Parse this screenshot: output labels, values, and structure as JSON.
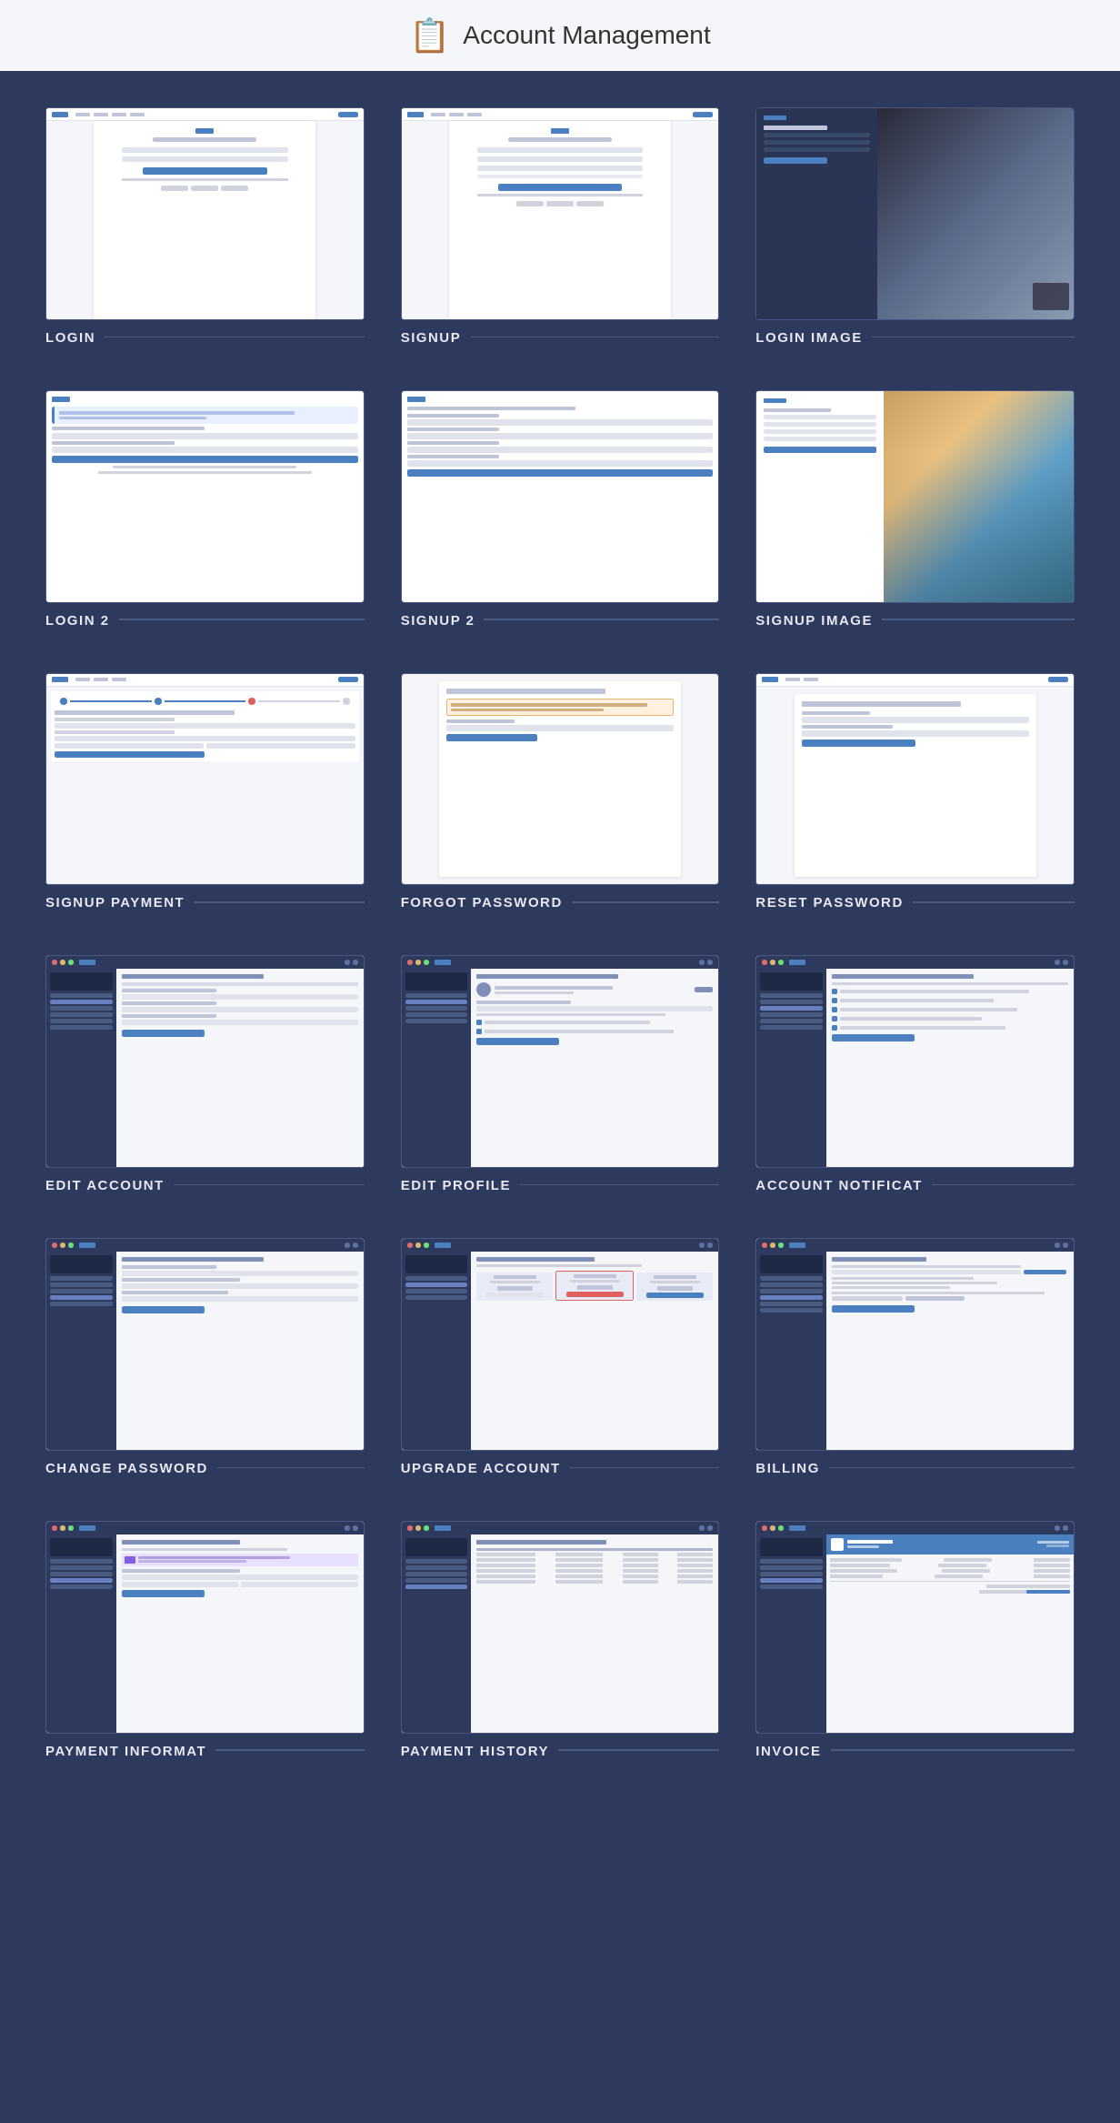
{
  "header": {
    "icon": "📋",
    "title": "Account Management"
  },
  "items": [
    {
      "id": "login",
      "label": "LOGIN",
      "type": "login"
    },
    {
      "id": "signup",
      "label": "SIGNUP",
      "type": "signup"
    },
    {
      "id": "login-image",
      "label": "LOGIN IMAGE",
      "type": "login-image"
    },
    {
      "id": "login2",
      "label": "LOGIN 2",
      "type": "login2"
    },
    {
      "id": "signup2",
      "label": "SIGNUP 2",
      "type": "signup2"
    },
    {
      "id": "signup-image",
      "label": "SIGNUP IMAGE",
      "type": "signup-image"
    },
    {
      "id": "signup-payment",
      "label": "SIGNUP PAYMENT",
      "type": "signup-payment"
    },
    {
      "id": "forgot-password",
      "label": "FORGOT PASSWORD",
      "type": "forgot-password"
    },
    {
      "id": "reset-password",
      "label": "RESET PASSWORD",
      "type": "reset-password"
    },
    {
      "id": "edit-account",
      "label": "EDIT ACCOUNT",
      "type": "edit-account"
    },
    {
      "id": "edit-profile",
      "label": "EDIT PROFILE",
      "type": "edit-profile"
    },
    {
      "id": "account-notifications",
      "label": "ACCOUNT NOTIFICAT",
      "type": "account-notifications"
    },
    {
      "id": "change-password",
      "label": "CHANGE PASSWORD",
      "type": "change-password"
    },
    {
      "id": "upgrade-account",
      "label": "UPGRADE ACCOUNT",
      "type": "upgrade-account"
    },
    {
      "id": "billing",
      "label": "BILLING",
      "type": "billing"
    },
    {
      "id": "payment-information",
      "label": "PAYMENT INFORMAT",
      "type": "payment-information"
    },
    {
      "id": "payment-history",
      "label": "PAYMENT HISTORY",
      "type": "payment-history"
    },
    {
      "id": "invoice",
      "label": "INVOICE",
      "type": "invoice"
    }
  ]
}
